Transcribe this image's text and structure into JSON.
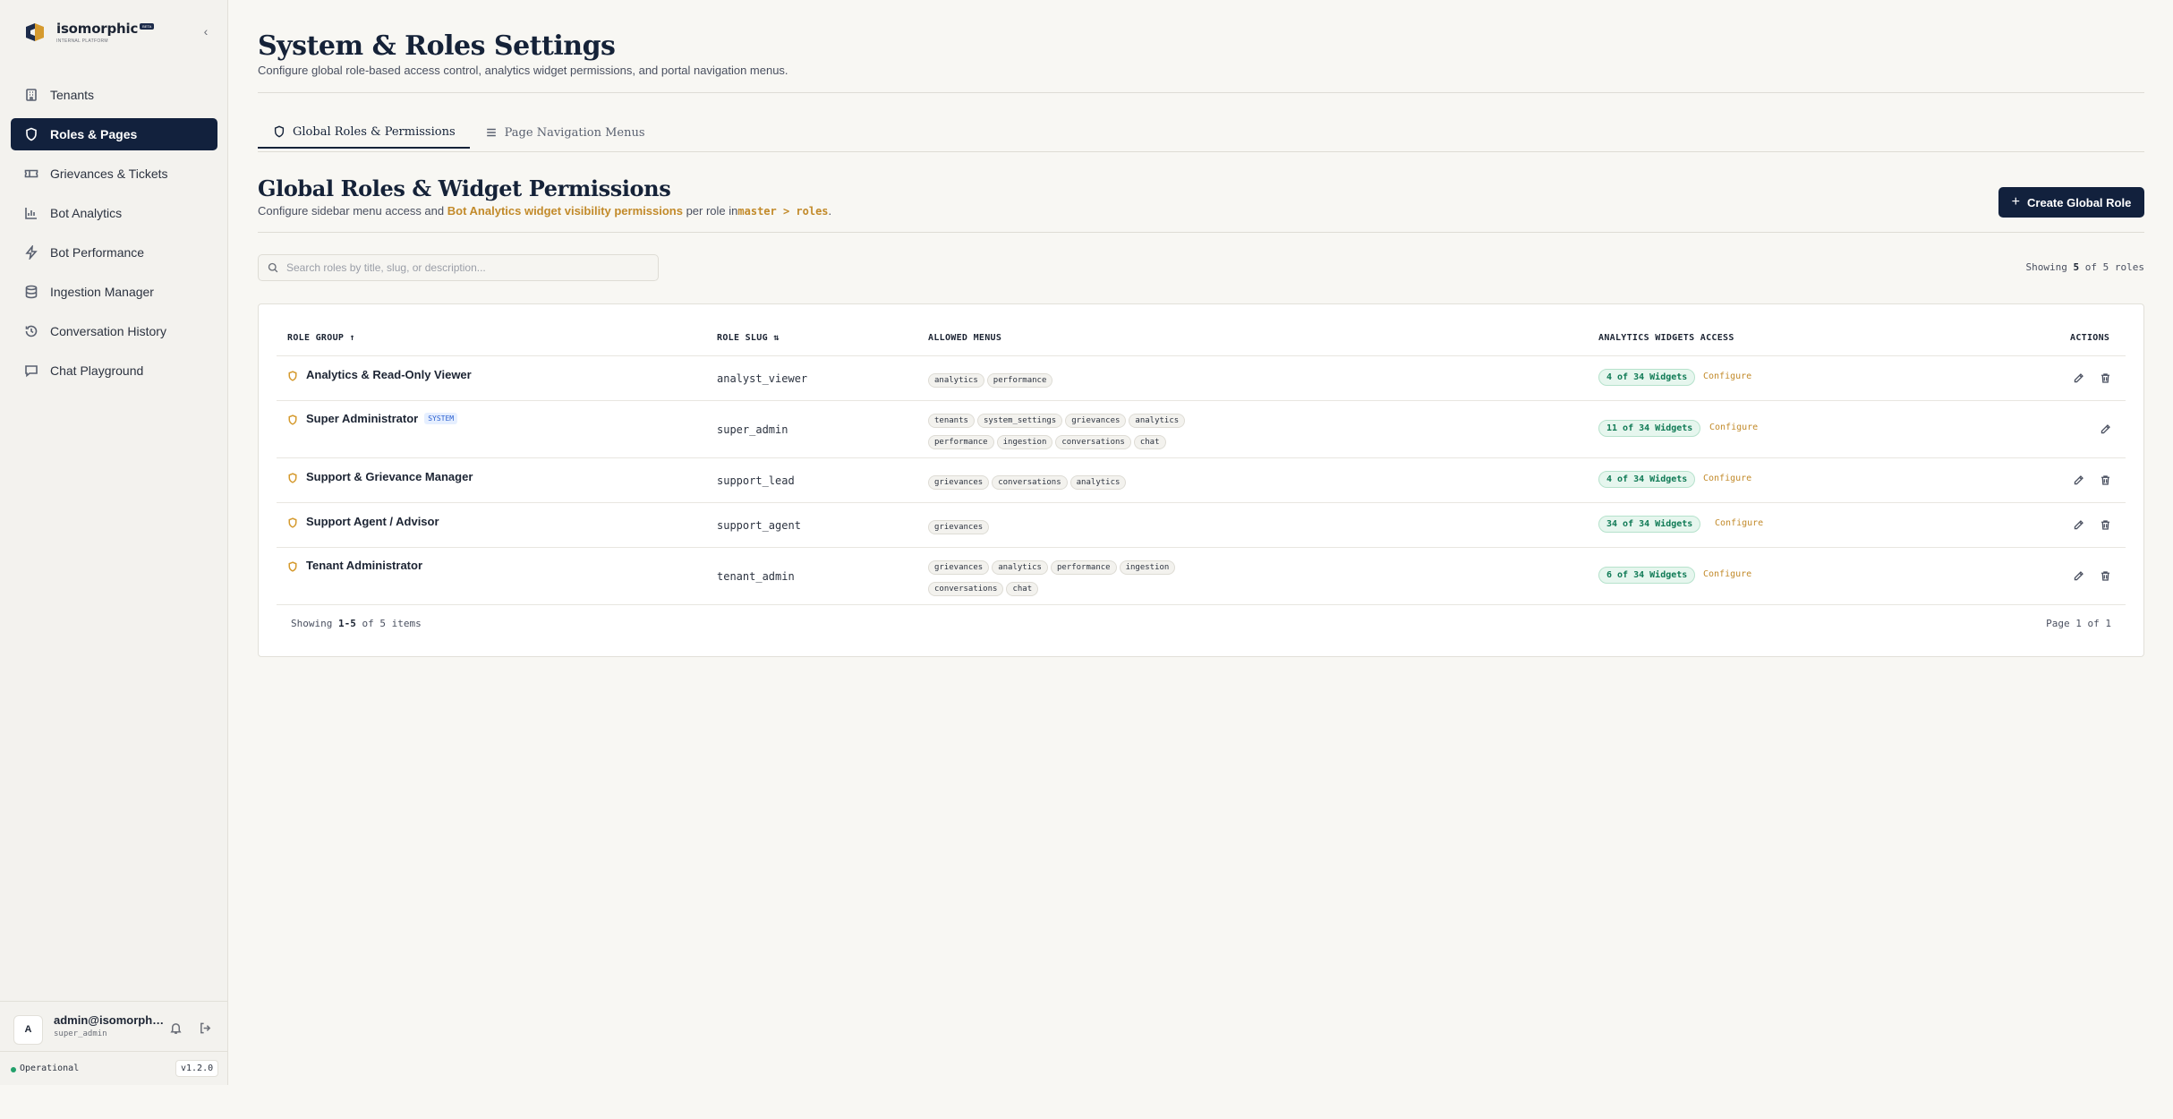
{
  "brand": {
    "name": "isomorphic",
    "badge": "BETA",
    "subtitle": "INTERNAL PLATFORM"
  },
  "sidebar": {
    "items": [
      {
        "label": "Tenants",
        "icon": "building-icon"
      },
      {
        "label": "Roles & Pages",
        "icon": "shield-icon",
        "active": true
      },
      {
        "label": "Grievances & Tickets",
        "icon": "ticket-icon"
      },
      {
        "label": "Bot Analytics",
        "icon": "bar-chart-icon"
      },
      {
        "label": "Bot Performance",
        "icon": "zap-icon"
      },
      {
        "label": "Ingestion Manager",
        "icon": "database-icon"
      },
      {
        "label": "Conversation History",
        "icon": "history-icon"
      },
      {
        "label": "Chat Playground",
        "icon": "message-icon"
      }
    ]
  },
  "user": {
    "initial": "A",
    "name": "admin@isomorph…",
    "role": "super_admin"
  },
  "status": {
    "text": "Operational",
    "version": "v1.2.0",
    "color": "#22a06b"
  },
  "header": {
    "title": "System & Roles Settings",
    "subtitle": "Configure global role-based access control, analytics widget permissions, and portal navigation menus."
  },
  "tabs": [
    {
      "label": "Global Roles & Permissions",
      "active": true
    },
    {
      "label": "Page Navigation Menus",
      "active": false
    }
  ],
  "section": {
    "title": "Global Roles & Widget Permissions",
    "sub_prefix": "Configure sidebar menu access and",
    "sub_highlight": "Bot Analytics widget visibility permissions",
    "sub_mid": "per role in",
    "sub_code": "master > roles",
    "sub_suffix": ".",
    "create_label": "Create Global Role"
  },
  "search": {
    "placeholder": "Search roles by title, slug, or description..."
  },
  "count": {
    "prefix": "Showing",
    "shown": "5",
    "suffix": "of 5 roles"
  },
  "table": {
    "headers": {
      "group": "ROLE GROUP ↑",
      "slug": "ROLE SLUG ⇅",
      "menus": "ALLOWED MENUS",
      "widgets": "ANALYTICS WIDGETS ACCESS",
      "actions": "ACTIONS"
    },
    "configure_label": "Configure",
    "rows": [
      {
        "name": "Analytics & Read-Only Viewer",
        "system": "",
        "slug": "analyst_viewer",
        "menus": [
          "analytics",
          "performance"
        ],
        "widgets": "4 of 34 Widgets",
        "deletable": true
      },
      {
        "name": "Super Administrator",
        "system": "SYSTEM",
        "slug": "super_admin",
        "menus": [
          "tenants",
          "system_settings",
          "grievances",
          "analytics",
          "performance",
          "ingestion",
          "conversations",
          "chat"
        ],
        "widgets": "11 of 34 Widgets",
        "deletable": false
      },
      {
        "name": "Support & Grievance Manager",
        "system": "",
        "slug": "support_lead",
        "menus": [
          "grievances",
          "conversations",
          "analytics"
        ],
        "widgets": "4 of 34 Widgets",
        "deletable": true
      },
      {
        "name": "Support Agent / Advisor",
        "system": "",
        "slug": "support_agent",
        "menus": [
          "grievances"
        ],
        "widgets": "34 of 34 Widgets",
        "deletable": true
      },
      {
        "name": "Tenant Administrator",
        "system": "",
        "slug": "tenant_admin",
        "menus": [
          "grievances",
          "analytics",
          "performance",
          "ingestion",
          "conversations",
          "chat"
        ],
        "widgets": "6 of 34 Widgets",
        "deletable": true
      }
    ],
    "footer": {
      "prefix": "Showing",
      "range": "1-5",
      "suffix": "of 5 items",
      "page": "Page 1 of 1"
    }
  }
}
